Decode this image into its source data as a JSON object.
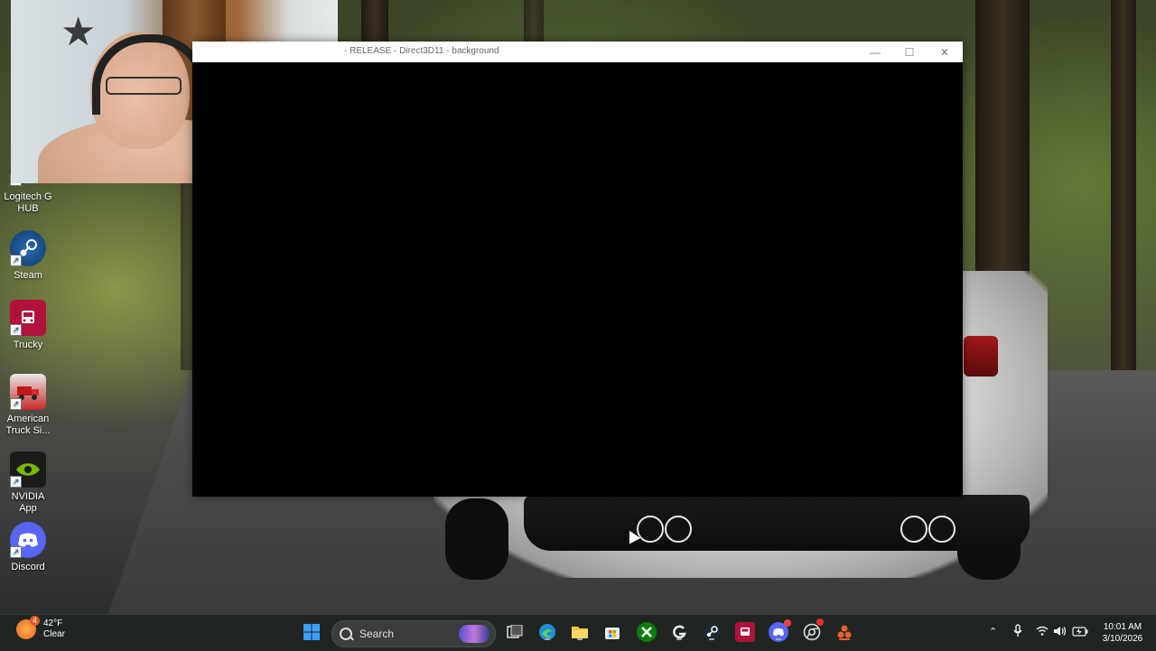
{
  "window": {
    "title": "- RELEASE - Direct3D11 - background",
    "minimize_glyph": "—",
    "maximize_glyph": "☐",
    "close_glyph": "✕"
  },
  "desktop_icons": [
    {
      "label": "Logitech G HUB",
      "icon": "logitech-ghub-icon"
    },
    {
      "label": "Steam",
      "icon": "steam-icon"
    },
    {
      "label": "Trucky",
      "icon": "trucky-icon"
    },
    {
      "label": "American Truck Si...",
      "icon": "american-truck-simulator-icon"
    },
    {
      "label": "NVIDIA App",
      "icon": "nvidia-icon"
    },
    {
      "label": "Discord",
      "icon": "discord-icon"
    }
  ],
  "taskbar": {
    "weather": {
      "temperature": "42°F",
      "condition": "Clear",
      "badge": "4"
    },
    "search_label": "Search",
    "pinned": [
      "windows-start-icon",
      "search-icon",
      "task-view-icon",
      "edge-icon",
      "file-explorer-icon",
      "microsoft-store-icon",
      "xbox-icon",
      "logitech-icon",
      "steam-icon",
      "trucky-icon",
      "discord-icon",
      "chrome-icon",
      "obs-icon"
    ],
    "tray": [
      "chevron-up-icon",
      "microphone-icon",
      "wifi-icon",
      "speaker-icon",
      "battery-icon"
    ],
    "time": "10:01 AM",
    "date": "3/10/2026"
  },
  "colors": {
    "taskbar_bg": "#202422",
    "window_client": "#000000",
    "titlebar": "#ffffff",
    "discord_brand": "#5865f2",
    "nvidia_brand": "#76b900",
    "steam_brand": "#1b2838"
  }
}
